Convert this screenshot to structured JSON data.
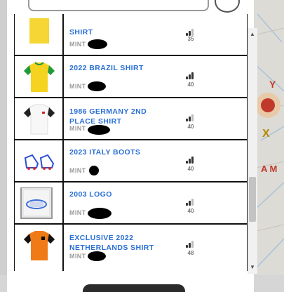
{
  "items": [
    {
      "title": "SHIRT",
      "mint": "MINT",
      "count": "35",
      "level": 2,
      "icon": "yellow-shirt-icon"
    },
    {
      "title": "2022 BRAZIL SHIRT",
      "mint": "MINT",
      "count": "40",
      "level": 3,
      "icon": "brazil-shirt-icon"
    },
    {
      "title": "1986 GERMANY 2ND PLACE SHIRT",
      "mint": "MINT",
      "count": "40",
      "level": 3,
      "icon": "germany-shirt-icon"
    },
    {
      "title": "2023 ITALY BOOTS",
      "mint": "MINT",
      "count": "40",
      "level": 4,
      "icon": "boots-icon"
    },
    {
      "title": "2003 LOGO",
      "mint": "MINT",
      "count": "40",
      "level": 3,
      "icon": "logo-icon"
    },
    {
      "title": "EXCLUSIVE 2022 NETHERLANDS SHIRT",
      "mint": "MINT",
      "count": "48",
      "level": 3,
      "icon": "netherlands-shirt-icon"
    }
  ],
  "colors": {
    "title": "#2a6fd6",
    "mint": "#9a9a9a",
    "signal_on": "#333333",
    "signal_off": "#bbbbbb"
  }
}
